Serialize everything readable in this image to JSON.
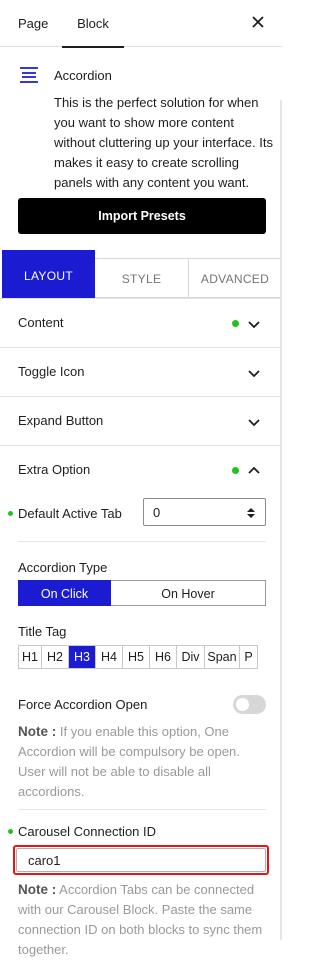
{
  "tabs": {
    "page": "Page",
    "block": "Block"
  },
  "block": {
    "icon": "accordion-lines-icon",
    "title": "Accordion",
    "description": "This is the perfect solution for when you want to show more content without cluttering up your interface. Its makes it easy to create scrolling panels with any content you want.",
    "import_label": "Import Presets"
  },
  "subtabs": {
    "layout": "LAYOUT",
    "style": "STYLE",
    "advanced": "ADVANCED"
  },
  "sections": {
    "content": "Content",
    "toggle_icon": "Toggle Icon",
    "expand_button": "Expand Button",
    "extra_option": "Extra Option"
  },
  "default_active_tab": {
    "label": "Default Active Tab",
    "value": "0"
  },
  "accordion_type": {
    "label": "Accordion Type",
    "options": [
      "On Click",
      "On Hover"
    ],
    "selected": "On Click"
  },
  "title_tag": {
    "label": "Title Tag",
    "options": [
      "H1",
      "H2",
      "H3",
      "H4",
      "H5",
      "H6",
      "Div",
      "Span",
      "P"
    ],
    "selected": "H3"
  },
  "force_open": {
    "label": "Force Accordion Open",
    "enabled": false,
    "note_label": "Note :",
    "note_text": "If you enable this option, One Accordion will be compulsory be open. User will not be able to disable all accordions."
  },
  "carousel": {
    "label": "Carousel Connection ID",
    "value": "caro1",
    "note_label": "Note :",
    "note_text": "Accordion Tabs can be connected with our Carousel Block. Paste the same connection ID on both blocks to sync them together."
  },
  "colors": {
    "accent": "#1b1bd1",
    "active_dot": "#21c21a",
    "highlight": "#e3151b"
  }
}
